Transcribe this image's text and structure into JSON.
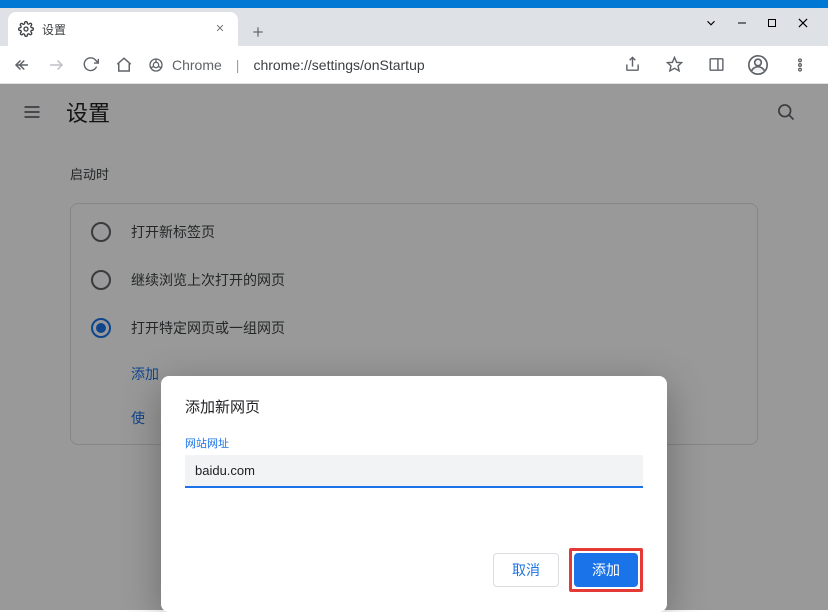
{
  "window": {
    "tab_title": "设置",
    "url_host": "Chrome",
    "url_path": "chrome://settings/onStartup"
  },
  "header": {
    "title": "设置"
  },
  "section": {
    "title": "启动时",
    "options": [
      "打开新标签页",
      "继续浏览上次打开的网页",
      "打开特定网页或一组网页"
    ],
    "link_add": "添加",
    "link_use": "使"
  },
  "dialog": {
    "title": "添加新网页",
    "field_label": "网站网址",
    "field_value": "baidu.com",
    "cancel": "取消",
    "add": "添加"
  }
}
